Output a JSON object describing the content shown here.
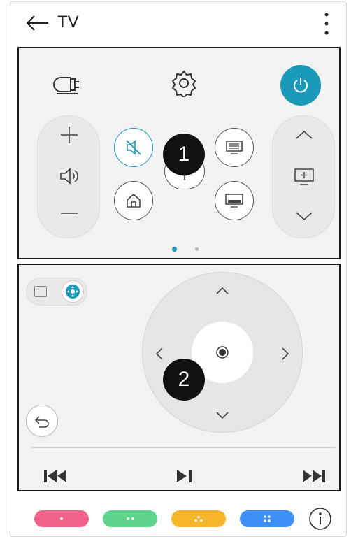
{
  "header": {
    "title": "TV"
  },
  "panel1": {
    "badge": "1",
    "page_count": 2,
    "active_page": 1
  },
  "panel2": {
    "badge": "2"
  },
  "colors": {
    "accent": "#1a9ab8",
    "red": "#f0628a",
    "green": "#5fd48f",
    "yellow": "#f7b529",
    "blue": "#3d8ef5"
  },
  "icons": {
    "input": "input-source-icon",
    "settings": "gear-icon",
    "power": "power-icon",
    "mute": "mute-icon",
    "home": "home-icon",
    "mic": "microphone-icon",
    "guide": "guide-icon",
    "subtitle": "subtitle-icon",
    "channel": "channel-list-icon"
  }
}
